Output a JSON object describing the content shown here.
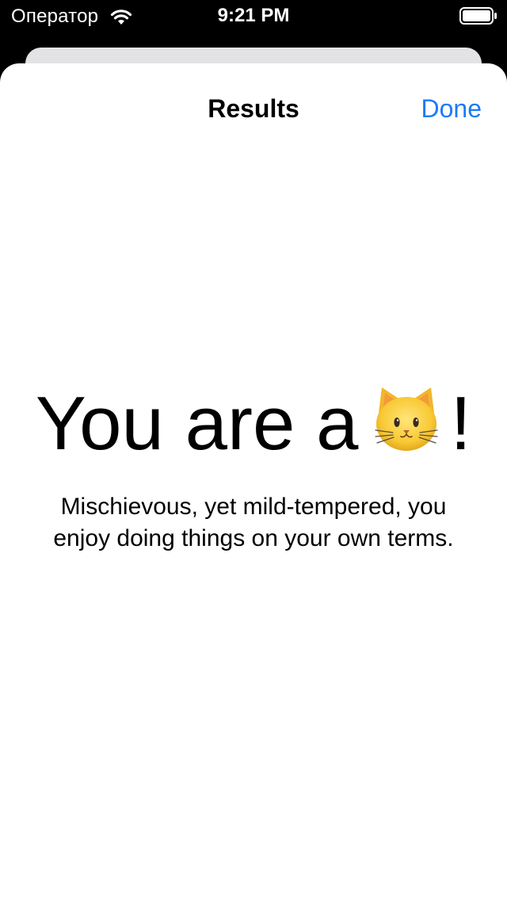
{
  "status_bar": {
    "carrier": "Оператор",
    "time": "9:21 PM",
    "icons": [
      "wifi-icon",
      "battery-icon"
    ]
  },
  "sheet": {
    "title": "Results",
    "done_label": "Done"
  },
  "result": {
    "heading_prefix": "You are a",
    "animal_icon": "cat-face-emoji",
    "heading_suffix": "!",
    "description": "Mischievous, yet mild-tempered, you enjoy doing things on your own terms."
  },
  "colors": {
    "accent": "#1a7cf5",
    "background": "#ffffff",
    "status_bar": "#000000",
    "back_card": "#e3e3e5"
  }
}
